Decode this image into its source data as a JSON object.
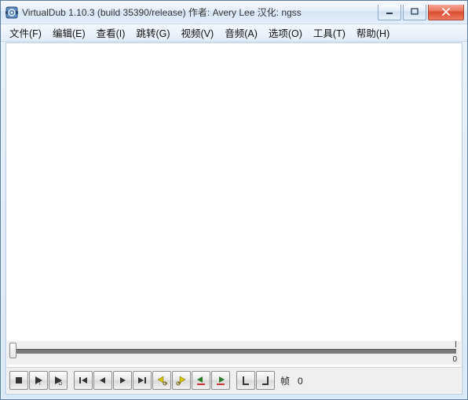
{
  "title": "VirtualDub 1.10.3 (build 35390/release) 作者: Avery Lee  汉化: ngss",
  "menu": {
    "file": "文件(F)",
    "edit": "编辑(E)",
    "view": "查看(I)",
    "goto": "跳转(G)",
    "video": "视频(V)",
    "audio": "音频(A)",
    "options": "选项(O)",
    "tools": "工具(T)",
    "help": "帮助(H)"
  },
  "timeline": {
    "end_value": "0"
  },
  "frame": {
    "label": "帧",
    "value": "0"
  },
  "icons": {
    "stop": "stop-icon",
    "play": "play-input-icon",
    "play_output": "play-output-icon",
    "go_start": "go-start-icon",
    "step_back": "step-back-icon",
    "step_fwd": "step-forward-icon",
    "go_end": "go-end-icon",
    "key_prev": "key-prev-icon",
    "key_next": "key-next-icon",
    "scene_prev": "scene-prev-icon",
    "scene_next": "scene-next-icon",
    "mark_in": "mark-in-icon",
    "mark_out": "mark-out-icon"
  }
}
